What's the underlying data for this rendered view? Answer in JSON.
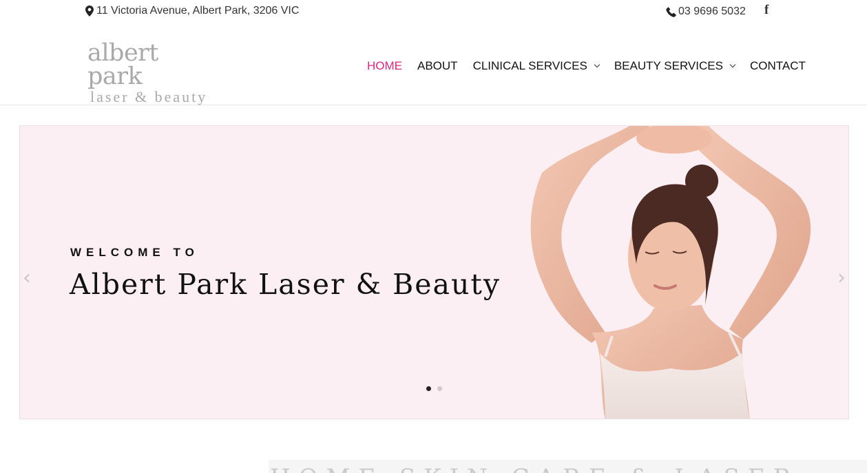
{
  "topbar": {
    "address": "11 Victoria Avenue, Albert Park, 3206 VIC",
    "phone": "03 9696 5032",
    "facebook_glyph": "f",
    "icons": {
      "address": "map-pin-icon",
      "phone": "phone-icon",
      "facebook": "facebook-icon"
    }
  },
  "logo": {
    "line1": "albert park",
    "line2": "laser & beauty"
  },
  "nav": {
    "items": [
      {
        "label": "HOME",
        "active": true,
        "dropdown": false
      },
      {
        "label": "ABOUT",
        "active": false,
        "dropdown": false
      },
      {
        "label": "CLINICAL SERVICES",
        "active": false,
        "dropdown": true
      },
      {
        "label": "BEAUTY SERVICES",
        "active": false,
        "dropdown": true
      },
      {
        "label": "CONTACT",
        "active": false,
        "dropdown": false
      }
    ]
  },
  "slider": {
    "kicker": "WELCOME TO",
    "headline": "Albert Park Laser & Beauty",
    "prev_glyph": "‹",
    "next_glyph": "›",
    "slide_count": 2,
    "current_slide": 1
  },
  "bottom": {
    "partial_heading": "HOME SKIN CARE & LASER"
  },
  "colors": {
    "accent": "#e0267f",
    "slider_bg": "#fbeff4",
    "logo_gray": "#a9a9a9"
  }
}
